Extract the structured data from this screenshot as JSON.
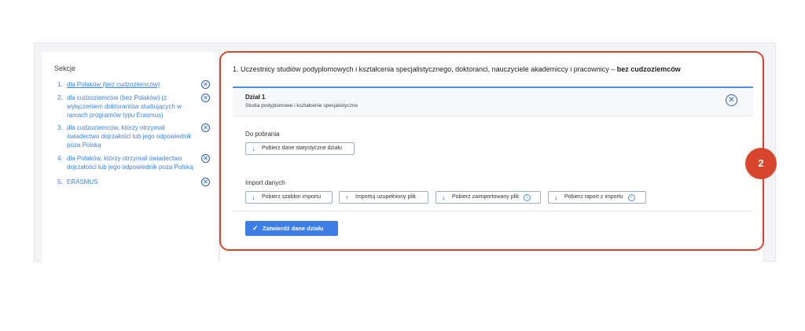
{
  "sidebar": {
    "title": "Sekcje",
    "items": [
      {
        "num": "1.",
        "label": "dla Polaków (bez cudzoziemców)"
      },
      {
        "num": "2.",
        "label": "dla cudzoziemców (bez Polaków) (z wyłączeniem doktorantów studiujących w ramach programów typu Erasmus)"
      },
      {
        "num": "3.",
        "label": "dla cudzoziemców, którzy otrzymali świadectwo dojrzałości lub jego odpowiednik poza Polską"
      },
      {
        "num": "4.",
        "label": "dla Polaków, którzy otrzymali świadectwo dojrzałości lub jego odpowiednik poza Polską"
      },
      {
        "num": "5.",
        "label": "ERASMUS"
      }
    ]
  },
  "main": {
    "title_prefix": "1. Uczestnicy studiów podyplomowych i kształcenia specjalistycznego, doktoranci, nauczyciele akademiccy i pracownicy – ",
    "title_bold": "bez cudzoziemców",
    "panel": {
      "title": "Dział 1",
      "subtitle": "Studia podyplomowe i kształcenie specjalistyczne"
    },
    "download": {
      "label": "Do pobrania",
      "button": "Pobierz dane statystyczne działu"
    },
    "import": {
      "label": "Import danych",
      "buttons": [
        "Pobierz szablon importu",
        "Importuj uzupełniony plik",
        "Pobierz zaimportowany plik",
        "Pobierz raport z importu"
      ]
    },
    "submit": "Zatwierdź dane działu"
  },
  "badge": "2",
  "colors": {
    "accent": "#3c7ee6",
    "highlight": "#d7452c",
    "link": "#3c83e8"
  }
}
